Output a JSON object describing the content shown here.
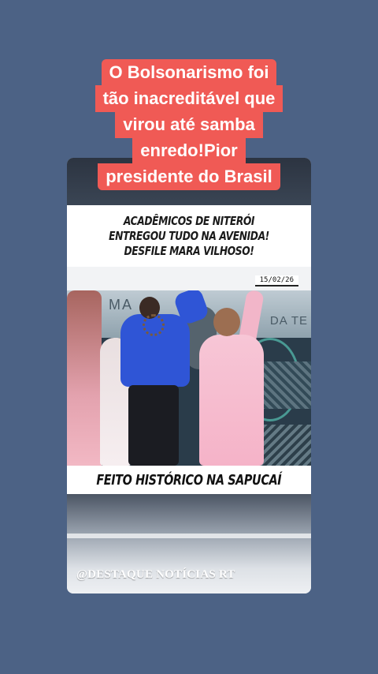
{
  "overlay_title": {
    "lines": [
      "O Bolsonarismo foi",
      "tão inacreditável que",
      "virou até samba",
      "enredo!Pior",
      "presidente do Brasil"
    ],
    "bg_color": "#f05a55",
    "text_color": "#ffffff"
  },
  "post": {
    "headline": "ACADÊMICOS DE NITERÓI ENTREGOU TUDO NA AVENIDA! DESFILE MARA VILHOSO!",
    "date": "15/02/26",
    "caption": "FEITO HISTÓRICO NA SAPUCAÍ",
    "watermark": "@DESTAQUE NOTÍCIAS RT"
  },
  "colors": {
    "page_background": "#4c6285"
  }
}
